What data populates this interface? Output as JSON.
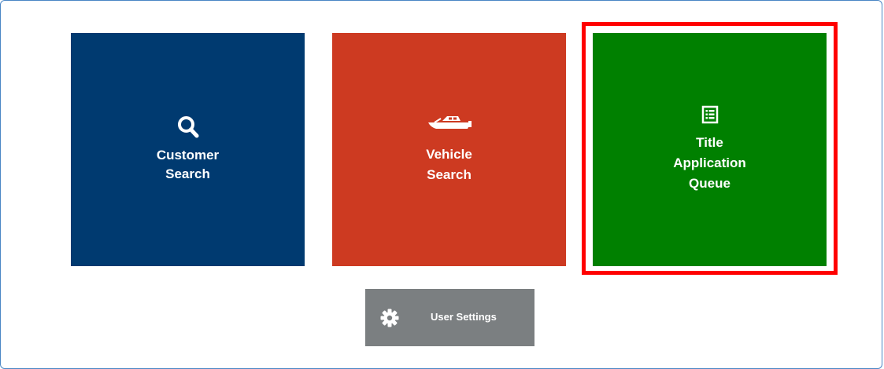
{
  "tiles": {
    "customer_search": {
      "icon": "search-icon",
      "line1": "Customer",
      "line2": "Search",
      "color": "#003a70"
    },
    "vehicle_search": {
      "icon": "boat-icon",
      "line1": "Vehicle",
      "line2": "Search",
      "color": "#cd3a21"
    },
    "title_application_queue": {
      "icon": "list-document-icon",
      "line1": "Title",
      "line2": "Application",
      "line3": "Queue",
      "color": "#008000",
      "highlighted": true,
      "highlight_color": "#ff0000"
    }
  },
  "user_settings": {
    "icon": "gear-icon",
    "label": "User Settings",
    "color": "#7b7f81"
  },
  "frame_border_color": "#4a86c5"
}
